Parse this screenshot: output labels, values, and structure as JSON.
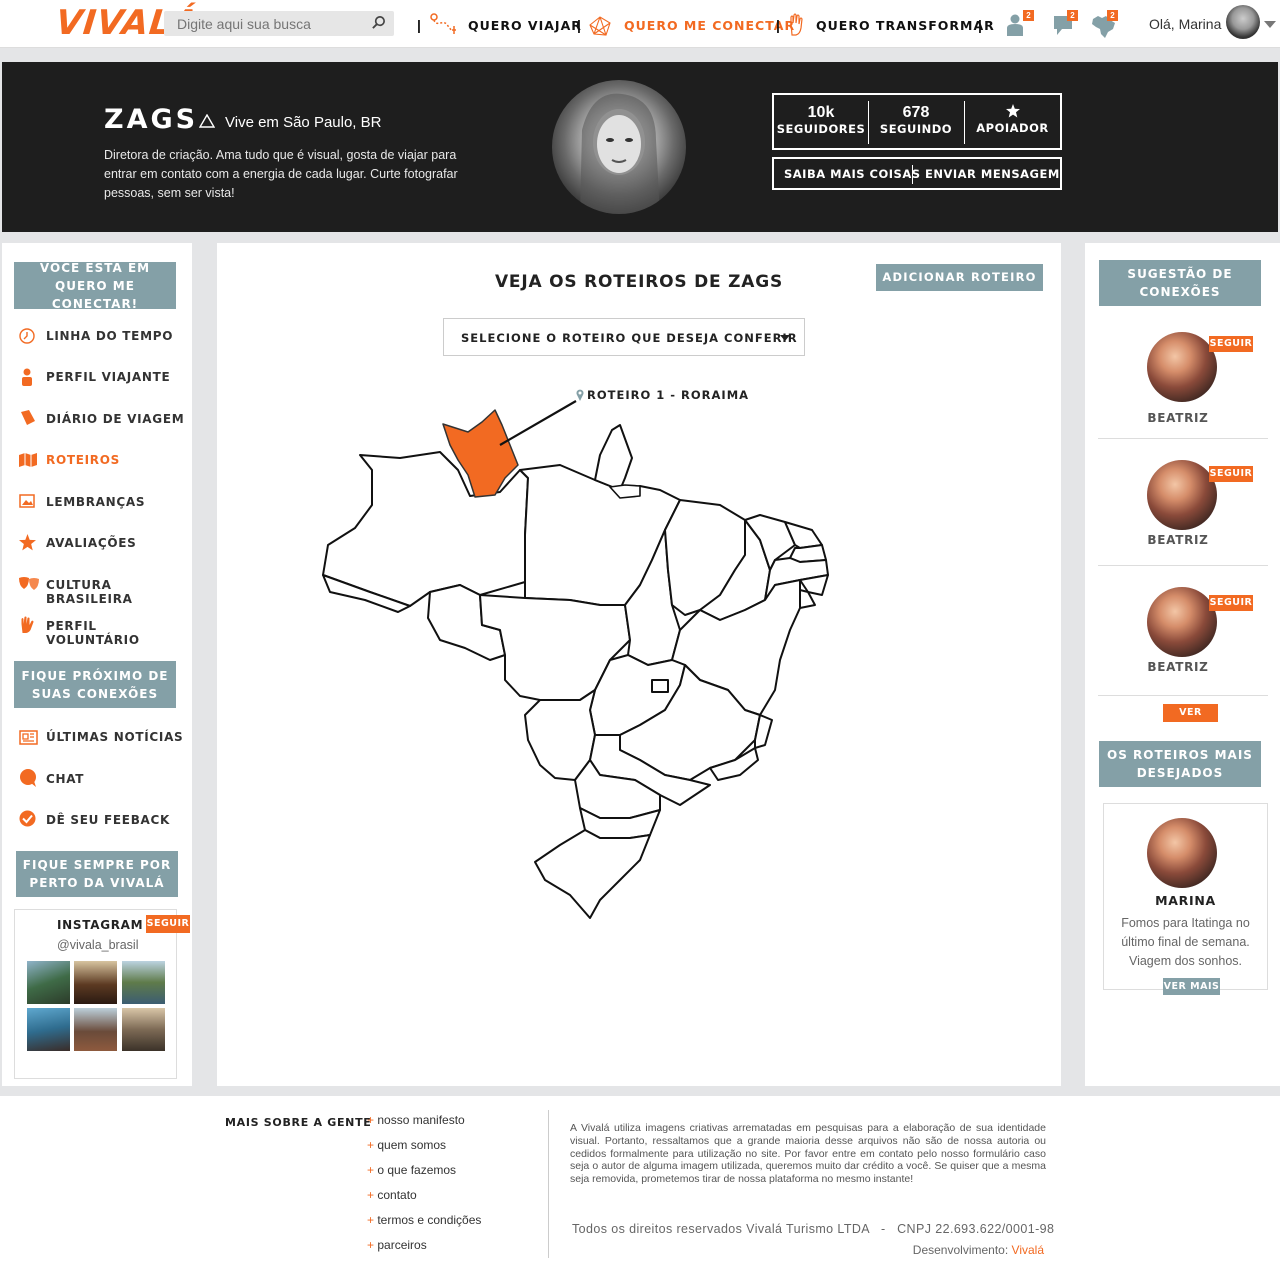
{
  "brand": {
    "logo_text": "VIVALÁ",
    "accent": "#f26a22",
    "slate": "#84a0a7"
  },
  "header": {
    "search_placeholder": "Digite aqui sua busca",
    "nav": [
      {
        "label": "QUERO VIAJAR"
      },
      {
        "label": "QUERO ME CONECTAR",
        "active": true
      },
      {
        "label": "QUERO TRANSFORMAR"
      }
    ],
    "badges": {
      "profile": "2",
      "messages": "2",
      "map": "2"
    },
    "greeting": "Olá, Marina"
  },
  "profile": {
    "name": "ZAGS",
    "location": "Vive em São Paulo, BR",
    "bio": "Diretora de criação. Ama tudo que é visual, gosta de viajar para entrar em contato com a energia de cada lugar. Curte fotografar pessoas, sem ser vista!",
    "followers_value": "10k",
    "followers_label": "SEGUIDORES",
    "following_value": "678",
    "following_label": "SEGUINDO",
    "supporter_label": "APOIADOR",
    "more_label": "SAIBA MAIS COISAS",
    "message_label": "ENVIAR MENSAGEM"
  },
  "sidebar": {
    "current_section": "VOCÊ ESTÁ EM QUERO ME CONECTAR!",
    "items": [
      {
        "label": "LINHA DO TEMPO",
        "icon": "clock-icon"
      },
      {
        "label": "PERFIL VIAJANTE",
        "icon": "person-icon"
      },
      {
        "label": "DIÁRIO DE VIAGEM",
        "icon": "book-icon"
      },
      {
        "label": "ROTEIROS",
        "icon": "map-icon",
        "active": true
      },
      {
        "label": "LEMBRANÇAS",
        "icon": "image-icon"
      },
      {
        "label": "AVALIAÇÕES",
        "icon": "star-icon"
      },
      {
        "label": "CULTURA BRASILEIRA",
        "icon": "masks-icon"
      },
      {
        "label": "PERFIL VOLUNTÁRIO",
        "icon": "hand-icon"
      }
    ],
    "connections_heading": "FIQUE PRÓXIMO DE SUAS CONEXÕES",
    "connection_items": [
      {
        "label": "ÚLTIMAS NOTÍCIAS",
        "icon": "newspaper-icon"
      },
      {
        "label": "CHAT",
        "icon": "chat-icon"
      },
      {
        "label": "DÊ SEU FEEBACK",
        "icon": "check-icon"
      }
    ],
    "vivala_heading": "FIQUE SEMPRE POR PERTO DA VIVALÁ",
    "instagram": {
      "title": "INSTAGRAM",
      "handle": "@vivala_brasil",
      "follow": "SEGUIR"
    }
  },
  "main": {
    "title": "VEJA OS ROTEIROS DE ZAGS",
    "add_button": "ADICIONAR ROTEIRO",
    "select_label": "SELECIONE O ROTEIRO QUE DESEJA CONFERIR",
    "route_label": "ROTEIRO 1 - RORAIMA",
    "highlighted_state": "Roraima"
  },
  "right": {
    "suggestions_heading": "SUGESTÃO DE CONEXÕES",
    "suggestions": [
      {
        "name": "BEATRIZ",
        "follow": "SEGUIR"
      },
      {
        "name": "BEATRIZ",
        "follow": "SEGUIR"
      },
      {
        "name": "BEATRIZ",
        "follow": "SEGUIR"
      }
    ],
    "see_more": "VER MAIS",
    "wished_heading": "OS ROTEIROS MAIS DESEJADOS",
    "wished_card": {
      "name": "MARINA",
      "text": "Fomos para Itatinga no último final de semana. Viagem dos sonhos.",
      "see_more": "VER MAIS"
    }
  },
  "footer": {
    "heading": "MAIS SOBRE A GENTE",
    "links": [
      "nosso manifesto",
      "quem somos",
      "o que fazemos",
      "contato",
      "termos e condições",
      "parceiros"
    ],
    "disclaimer": "A Vivalá utiliza imagens criativas arrematadas em pesquisas para a elaboração de sua identidade visual. Portanto, ressaltamos que a grande maioria desse arquivos não são de nossa autoria ou cedidos formalmente para utilização no site. Por favor entre em contato pelo nosso formulário caso seja o autor de alguma imagem utilizada, queremos muito dar crédito a você. Se quiser que a mesma seja removida, prometemos tirar de nossa plataforma no mesmo instante!",
    "rights": "Todos os direitos reservados Vivalá Turismo LTDA   -   CNPJ 22.693.622/0001-98",
    "dev_label": "Desenvolvimento:",
    "dev_name": "Vivalá"
  }
}
